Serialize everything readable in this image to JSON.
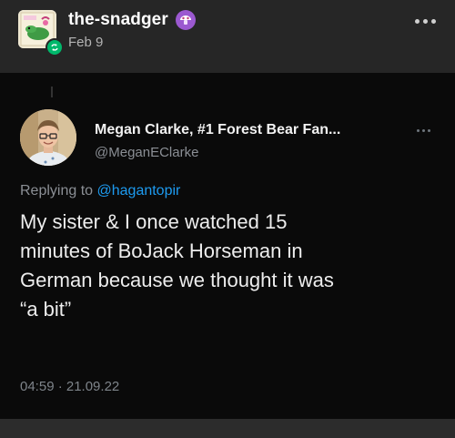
{
  "post": {
    "username": "the-snadger",
    "date": "Feb 9"
  },
  "tweet": {
    "display_name": "Megan Clarke, #1 Forest Bear Fan...",
    "handle": "@MeganEClarke",
    "replying_prefix": "Replying to",
    "replying_handle": "@hagantopir",
    "text_lines": [
      "My sister & I once watched 15",
      "minutes of BoJack Horseman in",
      "German because we thought it was",
      "“a bit”"
    ],
    "timestamp": "04:59 · 21.09.22"
  },
  "icons": {
    "avatar": "snadger-avatar",
    "reblog": "reblog-icon",
    "badge": "mushroom-badge-icon",
    "more": "more-options-icon",
    "tweet_more": "tweet-more-icon"
  },
  "colors": {
    "post_bg": "#262626",
    "tweet_bg": "#0a0a0a",
    "link": "#1d9bf0",
    "reblog": "#00b86b",
    "badge": "#9b59d0"
  }
}
